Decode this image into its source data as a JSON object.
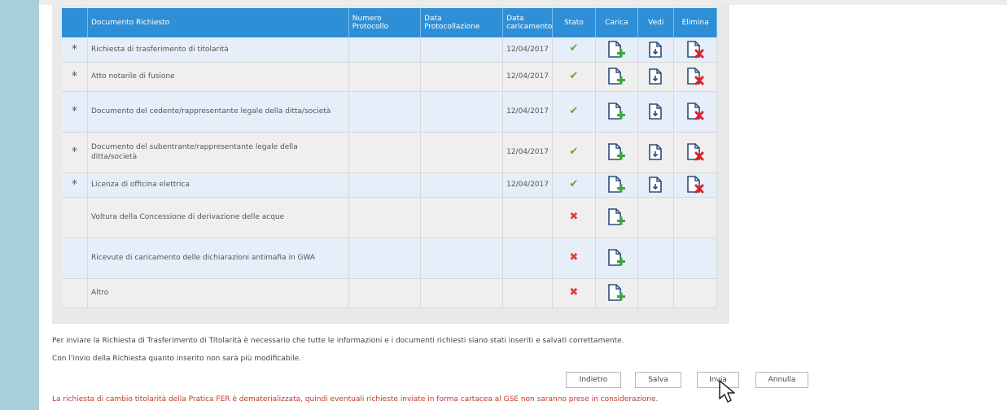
{
  "table": {
    "headers": {
      "documento": "Documento Richiesto",
      "numero": "Numero Protocollo",
      "data_protocollazione": "Data Protocollazione",
      "data_caricamento": "Data caricamento",
      "stato": "Stato",
      "carica": "Carica",
      "vedi": "Vedi",
      "elimina": "Elimina"
    },
    "rows": [
      {
        "required_mark": "*",
        "name": "Richiesta di trasferimento di titolarità",
        "numero": "",
        "data_protocollazione": "",
        "data_caricamento": "12/04/2017",
        "stato": "ok"
      },
      {
        "required_mark": "*",
        "name": "Atto notarile di fusione",
        "numero": "",
        "data_protocollazione": "",
        "data_caricamento": "12/04/2017",
        "stato": "ok"
      },
      {
        "required_mark": "*",
        "name": "Documento del cedente/rappresentante legale della ditta/società",
        "numero": "",
        "data_protocollazione": "",
        "data_caricamento": "12/04/2017",
        "stato": "ok"
      },
      {
        "required_mark": "*",
        "name": "Documento del subentrante/rappresentante legale della ditta/società",
        "numero": "",
        "data_protocollazione": "",
        "data_caricamento": "12/04/2017",
        "stato": "ok"
      },
      {
        "required_mark": "*",
        "name": "Licenza di officina elettrica",
        "numero": "",
        "data_protocollazione": "",
        "data_caricamento": "12/04/2017",
        "stato": "ok"
      },
      {
        "required_mark": "",
        "name": "Voltura della Concessione di derivazione delle acque",
        "numero": "",
        "data_protocollazione": "",
        "data_caricamento": "",
        "stato": "missing"
      },
      {
        "required_mark": "",
        "name": "Ricevute di caricamento delle dichiarazioni antimafia in GWA",
        "numero": "",
        "data_protocollazione": "",
        "data_caricamento": "",
        "stato": "missing"
      },
      {
        "required_mark": "",
        "name": "Altro",
        "numero": "",
        "data_protocollazione": "",
        "data_caricamento": "",
        "stato": "missing"
      }
    ]
  },
  "info": {
    "line1": "Per inviare la Richiesta di Trasferimento di Titolarità è necessario che tutte le informazioni e i documenti richiesti siano stati inseriti e salvati correttamente.",
    "line2": "Con l'invio della Richiesta quanto inserito non sarà più modificabile."
  },
  "buttons": {
    "back": "Indietro",
    "save": "Salva",
    "send": "Invia",
    "cancel": "Annulla"
  },
  "notice": "La richiesta di cambio titolarità della Pratica FER è dematerializzata, quindi eventuali richieste inviate in forma cartacea al GSE non saranno prese in considerazione.",
  "colors": {
    "header_blue": "#2f8fd6",
    "required_red": "#e0202a",
    "ok_green": "#5fa637",
    "left_bar": "#a9cfda"
  },
  "icons": {
    "stato_ok": "checkmark-icon",
    "stato_missing": "x-mark-icon",
    "carica": "upload-document-icon",
    "vedi": "view-document-icon",
    "elimina": "delete-document-icon"
  }
}
